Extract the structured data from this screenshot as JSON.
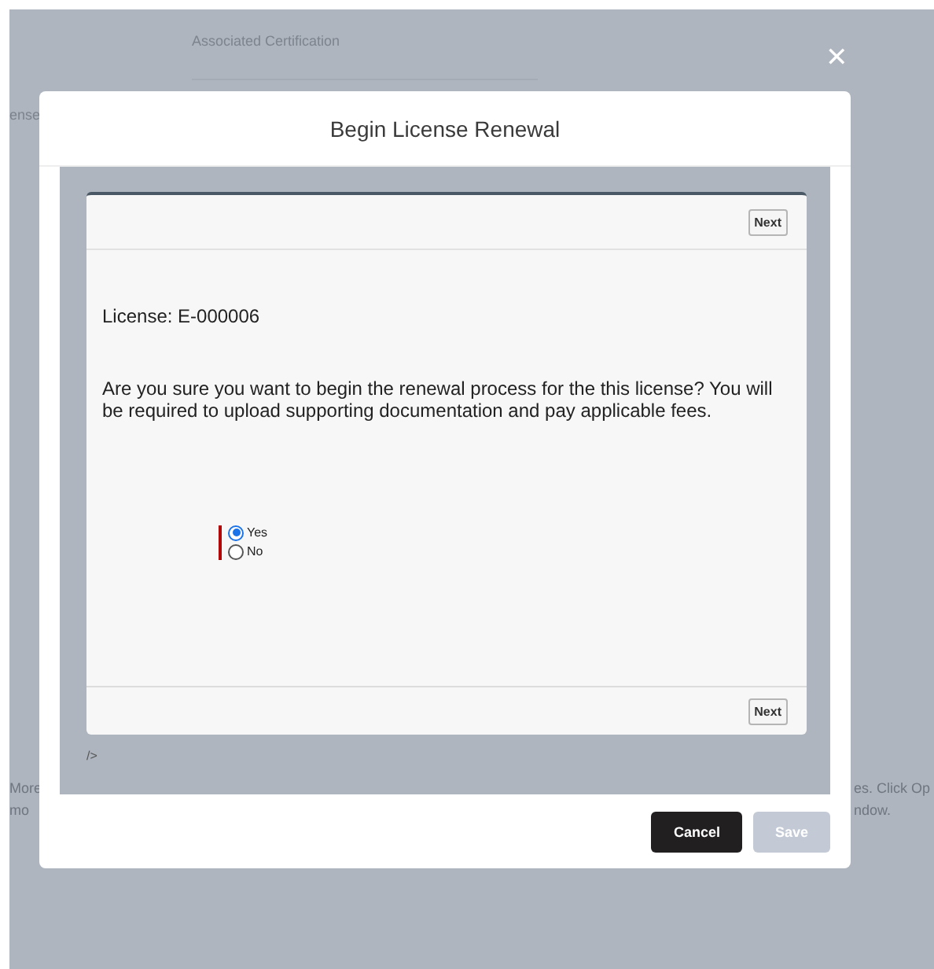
{
  "background": {
    "field_label": "Associated Certification",
    "left_fragment": "ense",
    "footer_left": [
      "More",
      "mo"
    ],
    "footer_right": [
      "es. Click Op",
      "ndow."
    ]
  },
  "modal": {
    "close": "✕",
    "title": "Begin License Renewal",
    "flow": {
      "top_button": "Next",
      "license": "License: E-000006",
      "question": "Are you sure you want to begin the renewal process for the this license? You will be required to upload supporting documentation and pay applicable fees.",
      "options": [
        {
          "label": "Yes",
          "selected": true
        },
        {
          "label": "No",
          "selected": false
        }
      ],
      "bottom_button": "Next"
    },
    "trailing_text": "/>",
    "buttons": [
      {
        "label": "Cancel",
        "disabled": false
      },
      {
        "label": "Save",
        "disabled": true
      }
    ]
  }
}
